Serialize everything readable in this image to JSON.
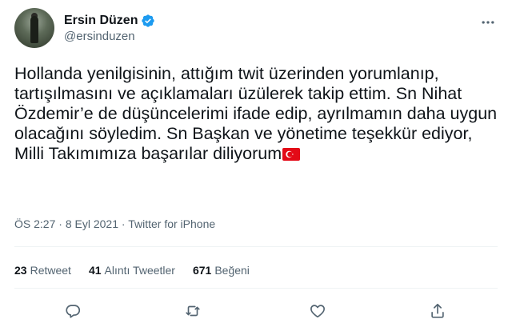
{
  "user": {
    "display_name": "Ersin Düzen",
    "handle": "@ersinduzen"
  },
  "tweet": {
    "text": "Hollanda yenilgisinin, attığım twit üzerinden yorumlanıp, tartışılmasını ve açıklamaları üzülerek takip ettim. Sn Nihat Özdemir’e de düşüncelerimi ifade edip, ayrılmamın daha uygun olacağını söyledim. Sn Başkan ve yönetime teşekkür ediyor, Milli Takımımıza başarılar diliyorum",
    "time": "ÖS 2:27",
    "separator": "·",
    "date": "8 Eyl 2021",
    "source": "Twitter for iPhone"
  },
  "stats": {
    "retweets_count": "23",
    "retweets_label": "Retweet",
    "quotes_count": "41",
    "quotes_label": "Alıntı Tweetler",
    "likes_count": "671",
    "likes_label": "Beğeni"
  },
  "colors": {
    "verified": "#1d9bf0",
    "secondary_text": "#536471",
    "flag_red": "#e30a17"
  },
  "icons": [
    "verified-icon",
    "more-icon",
    "turkish-flag-icon",
    "reply-icon",
    "retweet-icon",
    "like-icon",
    "share-icon"
  ]
}
